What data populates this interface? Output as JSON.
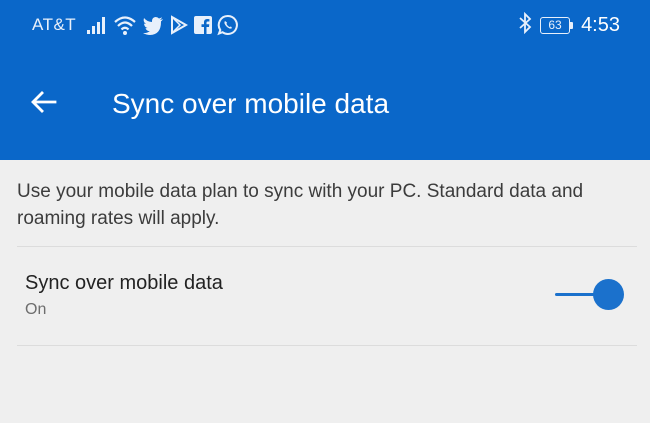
{
  "status_bar": {
    "carrier": "AT&T",
    "battery_level": "63",
    "time": "4:53",
    "icons": [
      "signal-icon",
      "wifi-icon",
      "twitter-icon",
      "play-store-icon",
      "facebook-icon",
      "whatsapp-icon",
      "bluetooth-icon",
      "battery-icon"
    ]
  },
  "app_bar": {
    "title": "Sync over mobile data",
    "back_icon": "back-arrow-icon",
    "color": "#0a67c9"
  },
  "description": "Use your mobile data plan to sync with your PC. Standard data and roaming rates will apply.",
  "setting": {
    "title": "Sync over mobile data",
    "status": "On",
    "toggle_on": true,
    "accent_color": "#1b71cc"
  }
}
